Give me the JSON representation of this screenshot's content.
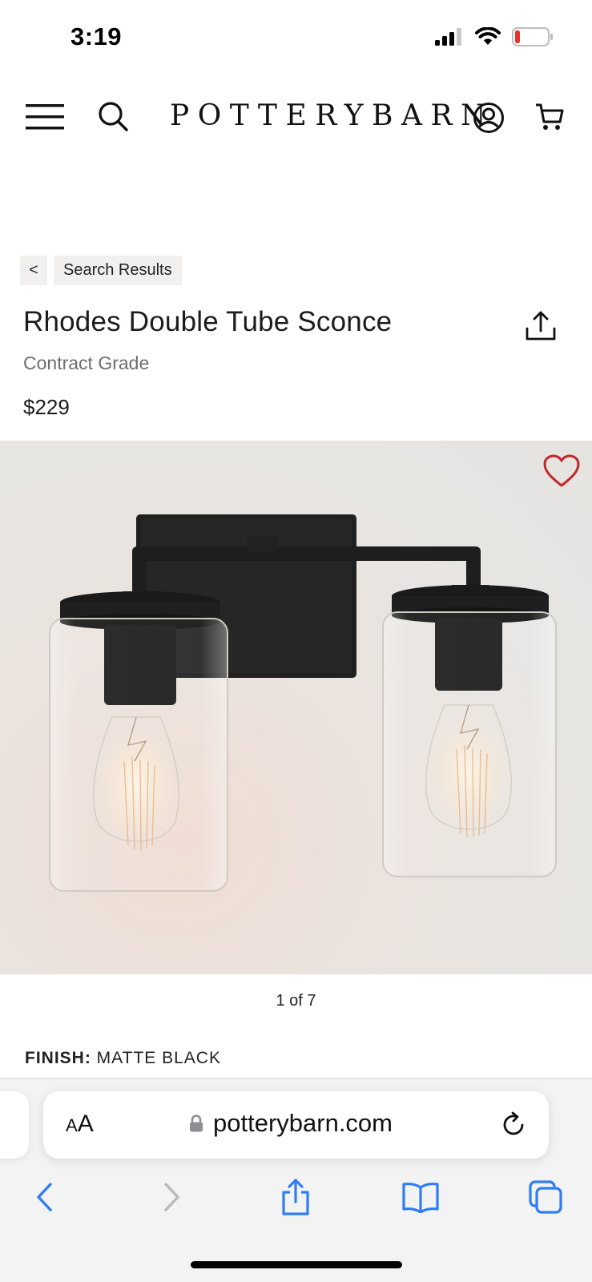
{
  "status_bar": {
    "time": "3:19"
  },
  "header": {
    "logo_first": "P",
    "logo_middle": "OTTERY",
    "logo_second": "B",
    "logo_last": "ARN",
    "icons": [
      "menu-icon",
      "search-icon",
      "account-icon",
      "cart-icon"
    ]
  },
  "breadcrumb": {
    "back_label": "<",
    "label": "Search Results"
  },
  "product": {
    "title": "Rhodes Double Tube Sconce",
    "subtitle": "Contract Grade",
    "price": "$229",
    "image_counter": "1 of 7",
    "finish_label": "FINISH:",
    "finish_value": "MATTE BLACK"
  },
  "colors": {
    "wishlist_heart": "#c0282d",
    "safari_blue": "#2f7cf6",
    "battery_low": "#e5322d"
  },
  "browser": {
    "aa_small": "A",
    "aa_large": "A",
    "url": "potterybarn.com",
    "toolbar_icons": [
      "back-icon",
      "forward-icon",
      "share-icon",
      "bookmarks-icon",
      "tabs-icon"
    ]
  }
}
